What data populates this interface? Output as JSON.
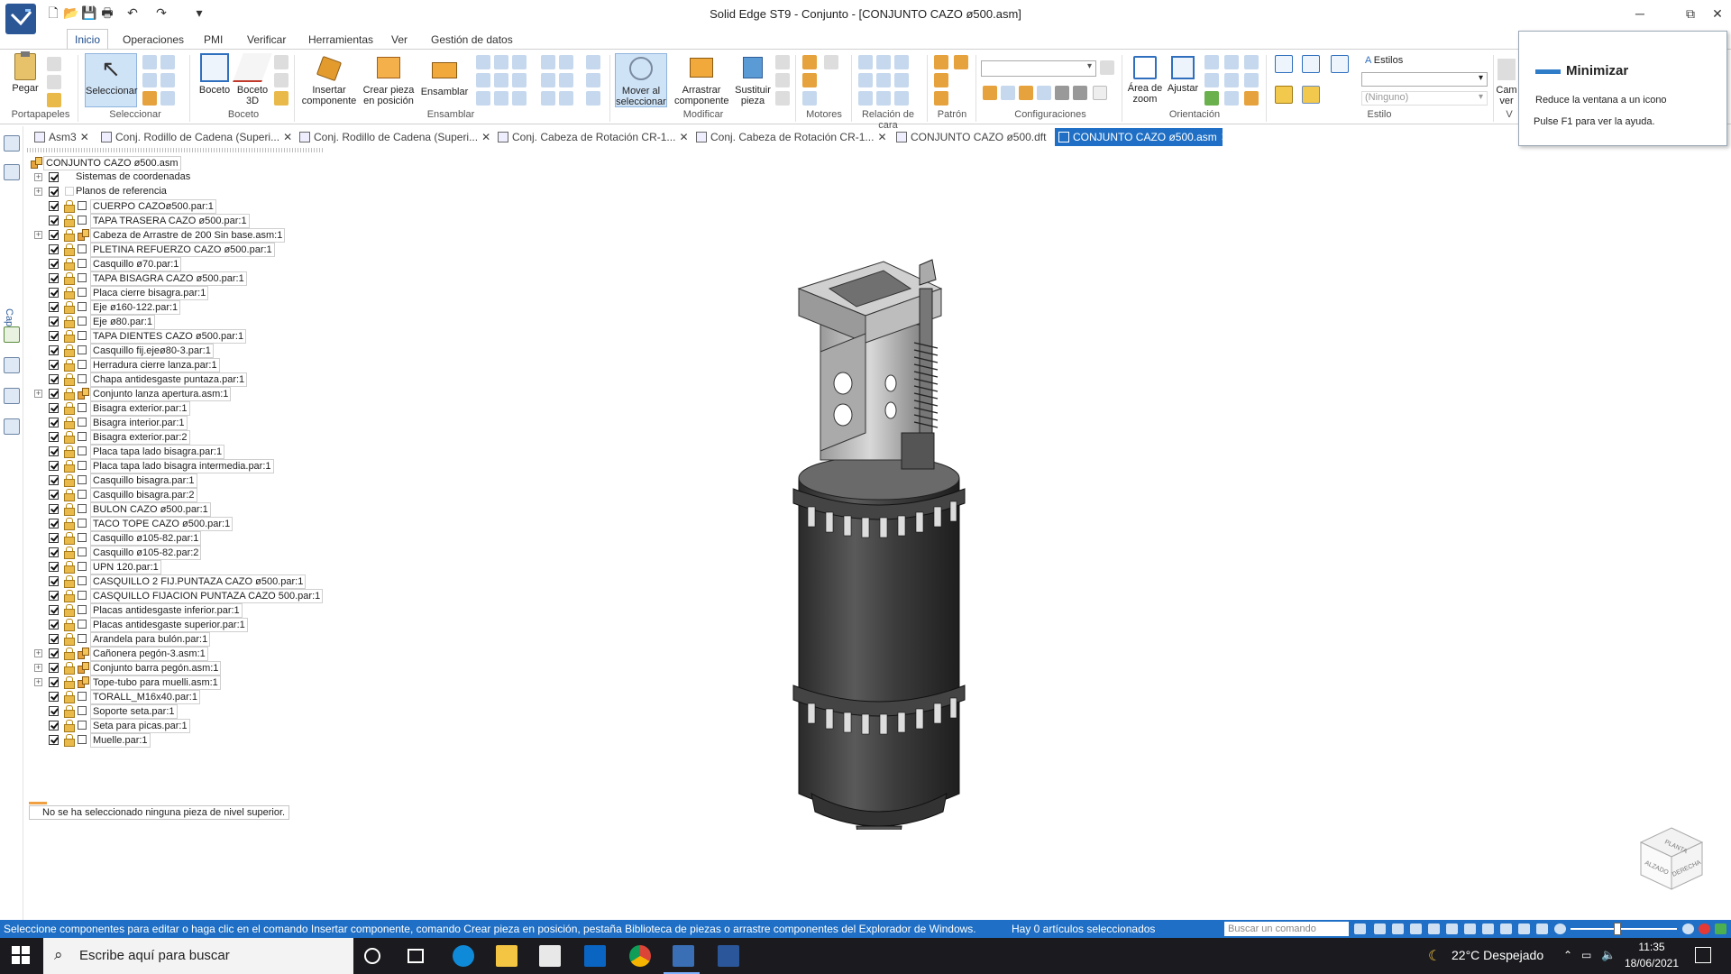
{
  "window": {
    "title": "Solid Edge ST9 - Conjunto - [CONJUNTO CAZO ø500.asm]",
    "minimize": "─",
    "restore": "⧉",
    "close": "✕"
  },
  "ribbon_tabs": [
    "Inicio",
    "Operaciones",
    "PMI",
    "Verificar",
    "Herramientas",
    "Ver",
    "Gestión de datos"
  ],
  "ribbon": {
    "paste": "Pegar",
    "select": "Seleccionar",
    "sketch": "Boceto",
    "sketch3d_1": "Boceto",
    "sketch3d_2": "3D",
    "insert_1": "Insertar",
    "insert_2": "componente",
    "create_1": "Crear pieza",
    "create_2": "en posición",
    "assemble": "Ensamblar",
    "move_1": "Mover al",
    "move_2": "seleccionar",
    "drag_1": "Arrastrar",
    "drag_2": "componente",
    "replace_1": "Sustituir",
    "replace_2": "pieza",
    "zoom_area_1": "Área de",
    "zoom_area_2": "zoom",
    "fit": "Ajustar",
    "camera_1": "Cam",
    "camera_2": "ver",
    "styles": "Estilos",
    "style_none": "(Ninguno)",
    "groups": {
      "clipboard": "Portapapeles",
      "select": "Seleccionar",
      "sketch": "Boceto",
      "assemble": "Ensamblar",
      "modify": "Modificar",
      "motors": "Motores",
      "face_relations": "Relación de cara",
      "pattern": "Patrón",
      "configurations": "Configuraciones",
      "orientation": "Orientación",
      "style": "Estilo",
      "view_short": "V"
    }
  },
  "tooltip": {
    "title": "Minimizar",
    "line1": "Reduce la ventana a un icono",
    "line2": "Pulse F1 para ver la ayuda."
  },
  "doc_tabs": [
    {
      "label": "Asm3",
      "active": false
    },
    {
      "label": "Conj. Rodillo de Cadena (Superi...",
      "active": false
    },
    {
      "label": "Conj. Rodillo de Cadena (Superi...",
      "active": false
    },
    {
      "label": "Conj. Cabeza de Rotación CR-1...",
      "active": false
    },
    {
      "label": "Conj. Cabeza de Rotación CR-1...",
      "active": false
    },
    {
      "label": "CONJUNTO CAZO ø500.dft",
      "active": false
    },
    {
      "label": "CONJUNTO CAZO ø500.asm",
      "active": true
    }
  ],
  "sidebar": {
    "layers_label": "Capas"
  },
  "tree": {
    "root": "CONJUNTO CAZO ø500.asm",
    "items": [
      {
        "label": "Sistemas de coordenadas",
        "kind": "system",
        "expand": true
      },
      {
        "label": "Planos de referencia",
        "kind": "planes",
        "expand": true
      },
      {
        "label": "CUERPO CAZOø500.par:1",
        "kind": "part"
      },
      {
        "label": "TAPA TRASERA CAZO ø500.par:1",
        "kind": "part"
      },
      {
        "label": "Cabeza de Arrastre de 200 Sin base.asm:1",
        "kind": "asm",
        "expand": true
      },
      {
        "label": "PLETINA REFUERZO CAZO ø500.par:1",
        "kind": "part"
      },
      {
        "label": "Casquillo ø70.par:1",
        "kind": "part"
      },
      {
        "label": "TAPA BISAGRA CAZO ø500.par:1",
        "kind": "part"
      },
      {
        "label": "Placa cierre bisagra.par:1",
        "kind": "part"
      },
      {
        "label": "Eje ø160-122.par:1",
        "kind": "part"
      },
      {
        "label": "Eje ø80.par:1",
        "kind": "part"
      },
      {
        "label": "TAPA DIENTES CAZO ø500.par:1",
        "kind": "part"
      },
      {
        "label": "Casquillo fij.ejeø80-3.par:1",
        "kind": "part"
      },
      {
        "label": "Herradura cierre lanza.par:1",
        "kind": "part"
      },
      {
        "label": "Chapa antidesgaste puntaza.par:1",
        "kind": "part"
      },
      {
        "label": "Conjunto lanza apertura.asm:1",
        "kind": "asm",
        "expand": true
      },
      {
        "label": "Bisagra exterior.par:1",
        "kind": "part"
      },
      {
        "label": "Bisagra interior.par:1",
        "kind": "part"
      },
      {
        "label": "Bisagra exterior.par:2",
        "kind": "part"
      },
      {
        "label": "Placa tapa lado bisagra.par:1",
        "kind": "part"
      },
      {
        "label": "Placa tapa lado bisagra intermedia.par:1",
        "kind": "part"
      },
      {
        "label": "Casquillo bisagra.par:1",
        "kind": "part"
      },
      {
        "label": "Casquillo bisagra.par:2",
        "kind": "part"
      },
      {
        "label": "BULON CAZO ø500.par:1",
        "kind": "part"
      },
      {
        "label": "TACO TOPE CAZO ø500.par:1",
        "kind": "part"
      },
      {
        "label": "Casquillo ø105-82.par:1",
        "kind": "part"
      },
      {
        "label": "Casquillo ø105-82.par:2",
        "kind": "part"
      },
      {
        "label": "UPN 120.par:1",
        "kind": "part"
      },
      {
        "label": "CASQUILLO 2 FIJ.PUNTAZA CAZO ø500.par:1",
        "kind": "part"
      },
      {
        "label": "CASQUILLO FIJACION PUNTAZA CAZO 500.par:1",
        "kind": "part"
      },
      {
        "label": "Placas antidesgaste inferior.par:1",
        "kind": "part"
      },
      {
        "label": "Placas antidesgaste superior.par:1",
        "kind": "part"
      },
      {
        "label": "Arandela para bulón.par:1",
        "kind": "part"
      },
      {
        "label": "Cañonera pegón-3.asm:1",
        "kind": "asm",
        "expand": true
      },
      {
        "label": "Conjunto barra pegón.asm:1",
        "kind": "asm",
        "expand": true
      },
      {
        "label": "Tope-tubo para muelli.asm:1",
        "kind": "asm",
        "expand": true
      },
      {
        "label": "TORALL_M16x40.par:1",
        "kind": "part"
      },
      {
        "label": "Soporte seta.par:1",
        "kind": "part"
      },
      {
        "label": "Seta para picas.par:1",
        "kind": "part"
      },
      {
        "label": "Muelle.par:1",
        "kind": "part"
      }
    ],
    "status": "No se ha seleccionado ninguna pieza de nivel superior."
  },
  "viewcube": {
    "top": "PLANTA",
    "left": "ALZADO",
    "right": "DERECHA"
  },
  "statusbar": {
    "message": "Seleccione componentes para editar o haga clic en el comando Insertar componente, comando Crear pieza en posición, pestaña Biblioteca de piezas o arrastre componentes del Explorador de Windows.",
    "selection": "Hay 0 artículos seleccionados",
    "search_placeholder": "Buscar un comando"
  },
  "taskbar": {
    "search_placeholder": "Escribe aquí para buscar",
    "weather": "22°C  Despejado",
    "time": "11:35",
    "date": "18/06/2021"
  }
}
